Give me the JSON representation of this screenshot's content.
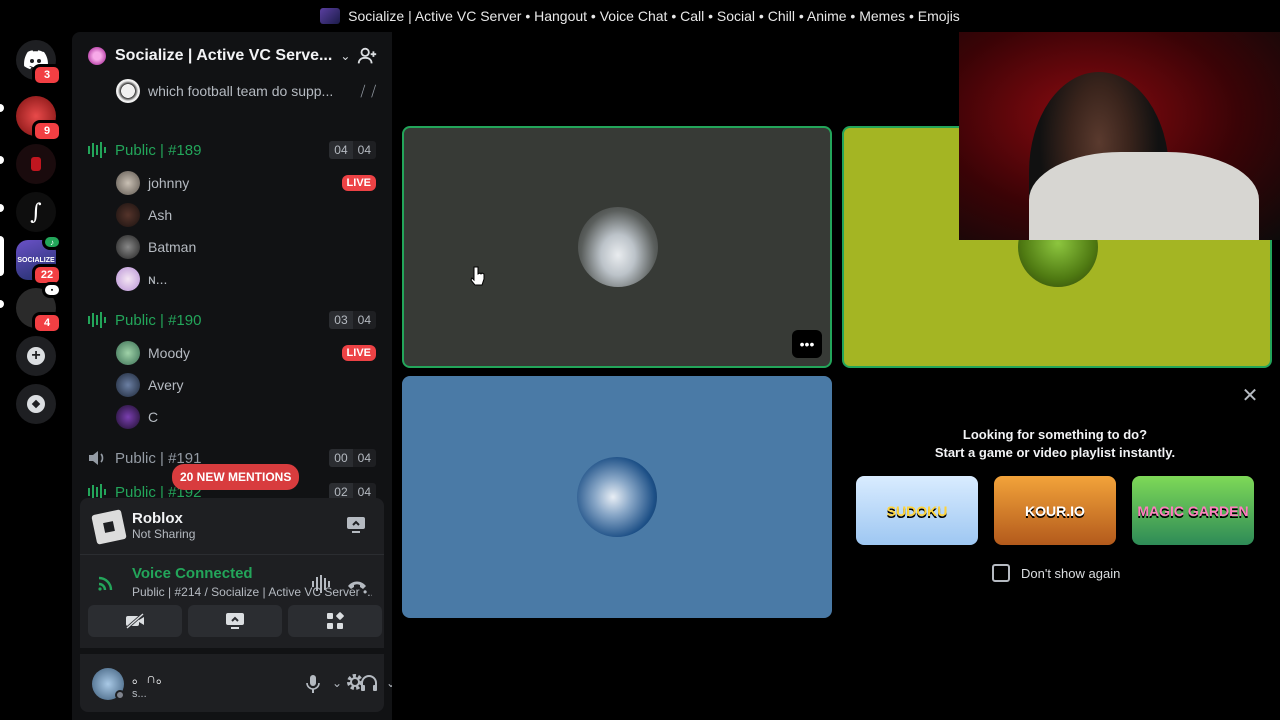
{
  "window": {
    "title": "Socialize | Active VC Server • Hangout • Voice Chat • Call • Social • Chill • Anime • Memes • Emojis"
  },
  "rail": {
    "home_badge": "3",
    "servers": [
      {
        "badge": "9"
      },
      {
        "badge": ""
      },
      {
        "badge": ""
      },
      {
        "badge": "22"
      },
      {
        "badge": "4"
      }
    ]
  },
  "sidebar": {
    "server_name": "Socialize | Active VC Serve...",
    "top_user": {
      "name": "which football team do supp..."
    },
    "channels": [
      {
        "name": "Public | #189",
        "count_left": "04",
        "count_right": "04",
        "color": "#23a55a",
        "users": [
          {
            "name": "johnny",
            "live": "LIVE"
          },
          {
            "name": "Ash"
          },
          {
            "name": "Batman"
          },
          {
            "name": "ɴ..."
          }
        ]
      },
      {
        "name": "Public | #190",
        "count_left": "03",
        "count_right": "04",
        "color": "#23a55a",
        "users": [
          {
            "name": "Moody",
            "live": "LIVE"
          },
          {
            "name": "Avery"
          },
          {
            "name": "C"
          }
        ]
      },
      {
        "name": "Public | #191",
        "count_left": "00",
        "count_right": "04",
        "color": "#949ba4"
      },
      {
        "name": "Public | #192",
        "count_left": "02",
        "count_right": "04",
        "color": "#23a55a"
      }
    ],
    "mentions_pill": "20 NEW MENTIONS"
  },
  "activity_panel": {
    "title": "Roblox",
    "subtitle": "Not Sharing"
  },
  "voice_panel": {
    "status": "Voice Connected",
    "location": "Public | #214 / Socialize | Active VC Server •..."
  },
  "user_panel": {
    "name": "。∩。",
    "status": "s..."
  },
  "main": {
    "activity_prompt": {
      "line1": "Looking for something to do?",
      "line2": "Start a game or video playlist instantly.",
      "games": [
        "SUDOKU",
        "KOUR.IO",
        "MAGIC GARDEN"
      ],
      "dont_show": "Don't show again"
    },
    "more_label": "•••"
  },
  "colors": {
    "accent_green": "#23a55a",
    "tile1_bg": "#373a36",
    "tile2_bg": "#a4b523",
    "tile3_bg": "#4a7aa6",
    "live_red": "#ed4245"
  }
}
